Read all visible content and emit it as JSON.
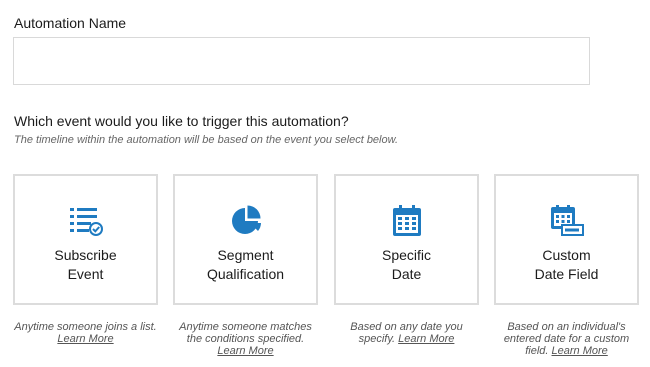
{
  "automation_name": {
    "label": "Automation Name",
    "value": "",
    "placeholder": ""
  },
  "trigger": {
    "question": "Which event would you like to trigger this automation?",
    "hint": "The timeline within the automation will be based on the event you select below."
  },
  "cards": [
    {
      "icon": "checklist-icon",
      "title_line1": "Subscribe",
      "title_line2": "Event",
      "description": "Anytime someone joins a list.",
      "link": "Learn More"
    },
    {
      "icon": "pie-chart-icon",
      "title_line1": "Segment",
      "title_line2": "Qualification",
      "description": "Anytime someone matches the conditions specified.",
      "link": "Learn More"
    },
    {
      "icon": "calendar-icon",
      "title_line1": "Specific",
      "title_line2": "Date",
      "description": "Based on any date you specify.",
      "link": "Learn More"
    },
    {
      "icon": "calendar-field-icon",
      "title_line1": "Custom",
      "title_line2": "Date Field",
      "description": "Based on an individual's entered date for a custom field.",
      "link": "Learn More"
    }
  ],
  "colors": {
    "accent": "#1f7bc1",
    "border": "#dcdcdc",
    "text": "#1b1b1b",
    "muted": "#666666"
  }
}
